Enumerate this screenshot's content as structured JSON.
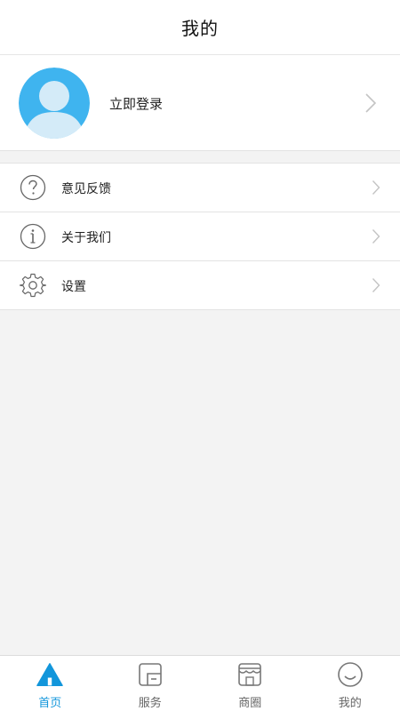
{
  "header": {
    "title": "我的"
  },
  "profile": {
    "login_label": "立即登录"
  },
  "menu": {
    "items": [
      {
        "label": "意见反馈",
        "icon": "question-circle-icon"
      },
      {
        "label": "关于我们",
        "icon": "info-circle-icon"
      },
      {
        "label": "设置",
        "icon": "gear-icon"
      }
    ]
  },
  "tabbar": {
    "active": "首页",
    "tabs": [
      {
        "label": "首页",
        "icon": "home-icon"
      },
      {
        "label": "服务",
        "icon": "service-icon"
      },
      {
        "label": "商圈",
        "icon": "shop-icon"
      },
      {
        "label": "我的",
        "icon": "smile-face-icon"
      }
    ]
  },
  "colors": {
    "accent": "#1296db",
    "avatar_bg": "#3fb4ef",
    "background": "#f3f3f3"
  }
}
